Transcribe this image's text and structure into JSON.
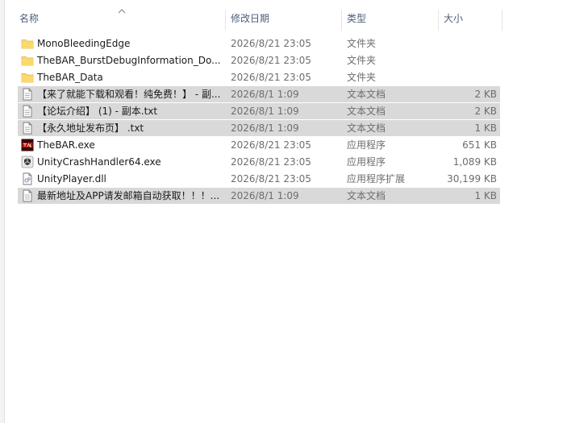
{
  "columns": {
    "name": "名称",
    "modified": "修改日期",
    "type": "类型",
    "size": "大小"
  },
  "files": [
    {
      "name": "MonoBleedingEdge",
      "modified": "2026/8/21 23:05",
      "type": "文件夹",
      "size": "",
      "icon": "folder-icon",
      "selected": false
    },
    {
      "name": "TheBAR_BurstDebugInformation_Do...",
      "modified": "2026/8/21 23:05",
      "type": "文件夹",
      "size": "",
      "icon": "folder-icon",
      "selected": false
    },
    {
      "name": "TheBAR_Data",
      "modified": "2026/8/21 23:05",
      "type": "文件夹",
      "size": "",
      "icon": "folder-icon",
      "selected": false
    },
    {
      "name": "【来了就能下载和观看！纯免费！】 - 副...",
      "modified": "2026/8/1 1:09",
      "type": "文本文档",
      "size": "2 KB",
      "icon": "text-file-icon",
      "selected": true
    },
    {
      "name": "【论坛介绍】 (1) - 副本.txt",
      "modified": "2026/8/1 1:09",
      "type": "文本文档",
      "size": "2 KB",
      "icon": "text-file-icon",
      "selected": true
    },
    {
      "name": "【永久地址发布页】 .txt",
      "modified": "2026/8/1 1:09",
      "type": "文本文档",
      "size": "1 KB",
      "icon": "text-file-icon",
      "selected": true
    },
    {
      "name": "TheBAR.exe",
      "modified": "2026/8/21 23:05",
      "type": "应用程序",
      "size": "651 KB",
      "icon": "game-exe-icon",
      "selected": false
    },
    {
      "name": "UnityCrashHandler64.exe",
      "modified": "2026/8/21 23:05",
      "type": "应用程序",
      "size": "1,089 KB",
      "icon": "unity-exe-icon",
      "selected": false
    },
    {
      "name": "UnityPlayer.dll",
      "modified": "2026/8/21 23:05",
      "type": "应用程序扩展",
      "size": "30,199 KB",
      "icon": "dll-file-icon",
      "selected": false
    },
    {
      "name": "最新地址及APP请发邮箱自动获取！！！...",
      "modified": "2026/8/1 1:09",
      "type": "文本文档",
      "size": "1 KB",
      "icon": "text-file-icon",
      "selected": true
    }
  ],
  "colors": {
    "selection": "#d9d9d9",
    "folder": "#f8d775",
    "header_text": "#4c607a"
  }
}
